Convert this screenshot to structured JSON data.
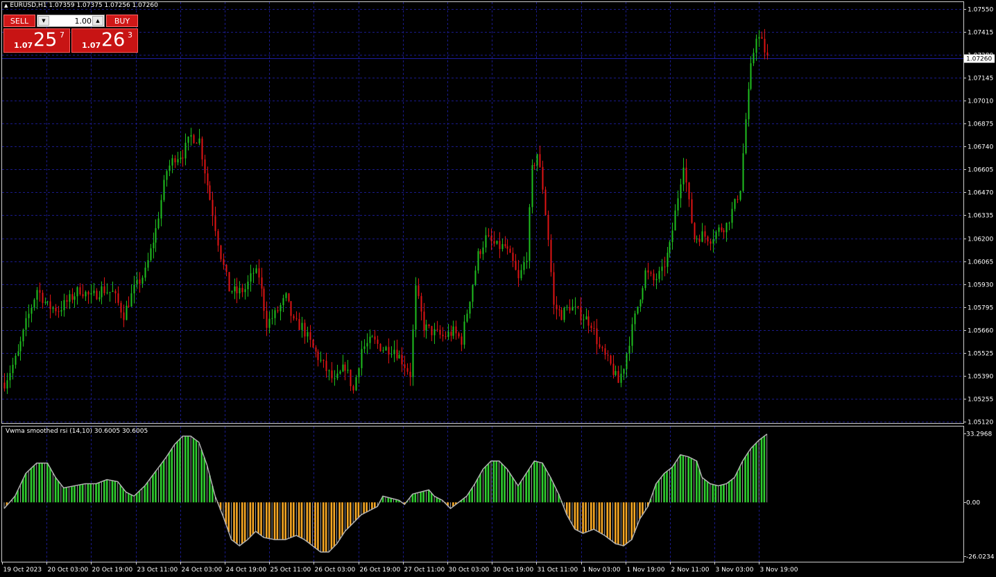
{
  "header": {
    "symbol_line": "EURUSD,H1  1.07359 1.07375 1.07256 1.07260"
  },
  "trade_panel": {
    "sell_label": "SELL",
    "buy_label": "BUY",
    "lot_value": "1.00",
    "sell_price_prefix": "1.07",
    "sell_price_main": "25",
    "sell_price_sup": "7",
    "buy_price_prefix": "1.07",
    "buy_price_main": "26",
    "buy_price_sup": "3"
  },
  "indicator": {
    "title": "Vwma smoothed rsi (14,10) 30.6005 30.6005",
    "scale_labels": [
      "33.2968",
      "0.00",
      "-26.0234"
    ],
    "scale_values": [
      33.2968,
      0,
      -26.0234
    ]
  },
  "colors": {
    "background": "#000000",
    "grid": "#1a1a8c",
    "bull": "#1fbf1f",
    "bear": "#e01414",
    "hist_up": "#2ecc2e",
    "hist_down": "#f5a623",
    "rsi_line": "#b0b0b0",
    "price_line": "#1e1e9e"
  },
  "icons": [
    "triangle-up-icon",
    "chevron-down-icon",
    "chevron-up-icon"
  ],
  "chart_data": {
    "type": "candlestick",
    "symbol": "EURUSD",
    "timeframe": "H1",
    "ohlc_current": {
      "open": 1.07359,
      "high": 1.07375,
      "low": 1.07256,
      "close": 1.0726
    },
    "current_price_label": "1.07260",
    "y_tick_labels": [
      "1.07550",
      "1.07415",
      "1.07280",
      "1.07145",
      "1.07010",
      "1.06875",
      "1.06740",
      "1.06605",
      "1.06470",
      "1.06335",
      "1.06200",
      "1.06065",
      "1.05930",
      "1.05795",
      "1.05660",
      "1.05525",
      "1.05390",
      "1.05255",
      "1.05120"
    ],
    "ylim": [
      1.0512,
      1.0755
    ],
    "x_tick_labels": [
      "19 Oct 2023",
      "20 Oct 03:00",
      "20 Oct 19:00",
      "23 Oct 11:00",
      "24 Oct 03:00",
      "24 Oct 19:00",
      "25 Oct 11:00",
      "26 Oct 03:00",
      "26 Oct 19:00",
      "27 Oct 11:00",
      "30 Oct 03:00",
      "30 Oct 19:00",
      "31 Oct 11:00",
      "1 Nov 03:00",
      "1 Nov 19:00",
      "2 Nov 11:00",
      "3 Nov 03:00",
      "3 Nov 19:00"
    ],
    "close_path_anchors": [
      [
        0,
        1.0535
      ],
      [
        5,
        1.0552
      ],
      [
        8,
        1.057
      ],
      [
        12,
        1.059
      ],
      [
        16,
        1.058
      ],
      [
        20,
        1.0578
      ],
      [
        24,
        1.0584
      ],
      [
        28,
        1.059
      ],
      [
        32,
        1.0585
      ],
      [
        36,
        1.059
      ],
      [
        40,
        1.0588
      ],
      [
        44,
        1.0575
      ],
      [
        48,
        1.059
      ],
      [
        52,
        1.06
      ],
      [
        56,
        1.0625
      ],
      [
        60,
        1.066
      ],
      [
        63,
        1.0668
      ],
      [
        66,
        1.067
      ],
      [
        69,
        1.068
      ],
      [
        72,
        1.0678
      ],
      [
        74,
        1.066
      ],
      [
        77,
        1.0635
      ],
      [
        80,
        1.061
      ],
      [
        83,
        1.059
      ],
      [
        86,
        1.0588
      ],
      [
        89,
        1.059
      ],
      [
        92,
        1.06
      ],
      [
        94,
        1.0598
      ],
      [
        97,
        1.057
      ],
      [
        100,
        1.0575
      ],
      [
        104,
        1.0585
      ],
      [
        107,
        1.057
      ],
      [
        110,
        1.0568
      ],
      [
        114,
        1.0555
      ],
      [
        118,
        1.0545
      ],
      [
        122,
        1.0535
      ],
      [
        126,
        1.0545
      ],
      [
        129,
        1.053
      ],
      [
        132,
        1.0555
      ],
      [
        136,
        1.056
      ],
      [
        140,
        1.0555
      ],
      [
        144,
        1.0555
      ],
      [
        147,
        1.0548
      ],
      [
        150,
        1.054
      ],
      [
        152,
        1.059
      ],
      [
        155,
        1.0568
      ],
      [
        158,
        1.0565
      ],
      [
        162,
        1.0562
      ],
      [
        166,
        1.0565
      ],
      [
        169,
        1.056
      ],
      [
        172,
        1.0585
      ],
      [
        175,
        1.061
      ],
      [
        178,
        1.062
      ],
      [
        182,
        1.0615
      ],
      [
        185,
        1.0615
      ],
      [
        188,
        1.0605
      ],
      [
        190,
        1.0595
      ],
      [
        193,
        1.061
      ],
      [
        195,
        1.066
      ],
      [
        197,
        1.067
      ],
      [
        199,
        1.065
      ],
      [
        201,
        1.062
      ],
      [
        203,
        1.058
      ],
      [
        206,
        1.0575
      ],
      [
        209,
        1.058
      ],
      [
        213,
        1.0575
      ],
      [
        217,
        1.057
      ],
      [
        220,
        1.0555
      ],
      [
        224,
        1.0545
      ],
      [
        227,
        1.0535
      ],
      [
        229,
        1.0545
      ],
      [
        231,
        1.056
      ],
      [
        234,
        1.058
      ],
      [
        237,
        1.06
      ],
      [
        240,
        1.0595
      ],
      [
        243,
        1.06
      ],
      [
        246,
        1.0615
      ],
      [
        249,
        1.0645
      ],
      [
        251,
        1.0665
      ],
      [
        253,
        1.064
      ],
      [
        255,
        1.062
      ],
      [
        258,
        1.0622
      ],
      [
        261,
        1.062
      ],
      [
        264,
        1.0625
      ],
      [
        267,
        1.0628
      ],
      [
        270,
        1.064
      ],
      [
        272,
        1.065
      ],
      [
        274,
        1.069
      ],
      [
        276,
        1.072
      ],
      [
        278,
        1.074
      ],
      [
        280,
        1.0735
      ],
      [
        282,
        1.0726
      ]
    ],
    "indicator_series": {
      "name": "Vwma smoothed rsi (14,10)",
      "last_value": 30.6005,
      "ylim": [
        -26.0234,
        33.2968
      ],
      "anchors": [
        [
          0,
          -3
        ],
        [
          4,
          3
        ],
        [
          8,
          14
        ],
        [
          12,
          19
        ],
        [
          16,
          19
        ],
        [
          19,
          12
        ],
        [
          22,
          7
        ],
        [
          26,
          8
        ],
        [
          30,
          9
        ],
        [
          34,
          9
        ],
        [
          38,
          11
        ],
        [
          42,
          10
        ],
        [
          45,
          5
        ],
        [
          48,
          3
        ],
        [
          52,
          8
        ],
        [
          56,
          15
        ],
        [
          60,
          22
        ],
        [
          63,
          28
        ],
        [
          66,
          32
        ],
        [
          69,
          32
        ],
        [
          72,
          29
        ],
        [
          75,
          18
        ],
        [
          78,
          3
        ],
        [
          81,
          -7
        ],
        [
          84,
          -18
        ],
        [
          87,
          -21
        ],
        [
          90,
          -18
        ],
        [
          93,
          -14
        ],
        [
          96,
          -17
        ],
        [
          100,
          -18
        ],
        [
          104,
          -18
        ],
        [
          108,
          -16
        ],
        [
          111,
          -18
        ],
        [
          114,
          -21
        ],
        [
          117,
          -24
        ],
        [
          120,
          -24
        ],
        [
          123,
          -20
        ],
        [
          126,
          -14
        ],
        [
          129,
          -10
        ],
        [
          132,
          -6
        ],
        [
          135,
          -4
        ],
        [
          138,
          -2
        ],
        [
          140,
          3
        ],
        [
          143,
          2
        ],
        [
          146,
          1
        ],
        [
          148,
          -1
        ],
        [
          151,
          4
        ],
        [
          154,
          5
        ],
        [
          157,
          6
        ],
        [
          159,
          3
        ],
        [
          162,
          1
        ],
        [
          165,
          -3
        ],
        [
          168,
          0
        ],
        [
          171,
          3
        ],
        [
          174,
          9
        ],
        [
          177,
          16
        ],
        [
          180,
          20
        ],
        [
          183,
          20
        ],
        [
          186,
          16
        ],
        [
          188,
          12
        ],
        [
          190,
          8
        ],
        [
          193,
          14
        ],
        [
          196,
          20
        ],
        [
          199,
          19
        ],
        [
          202,
          12
        ],
        [
          205,
          4
        ],
        [
          208,
          -6
        ],
        [
          211,
          -13
        ],
        [
          214,
          -15
        ],
        [
          218,
          -13
        ],
        [
          222,
          -16
        ],
        [
          226,
          -20
        ],
        [
          229,
          -21
        ],
        [
          232,
          -18
        ],
        [
          235,
          -8
        ],
        [
          238,
          -2
        ],
        [
          241,
          9
        ],
        [
          244,
          14
        ],
        [
          247,
          17
        ],
        [
          250,
          23
        ],
        [
          253,
          22
        ],
        [
          256,
          20
        ],
        [
          258,
          12
        ],
        [
          261,
          9
        ],
        [
          264,
          8
        ],
        [
          267,
          9
        ],
        [
          270,
          12
        ],
        [
          273,
          20
        ],
        [
          276,
          26
        ],
        [
          279,
          30
        ],
        [
          282,
          33
        ]
      ]
    }
  }
}
